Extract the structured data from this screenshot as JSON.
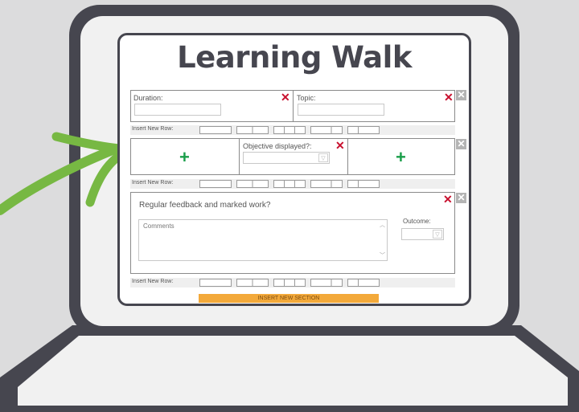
{
  "page": {
    "title": "Learning Walk"
  },
  "row1": {
    "duration_label": "Duration:",
    "topic_label": "Topic:"
  },
  "insert_row_label": "Insert New Row:",
  "row2": {
    "objective_label": "Objective displayed?:"
  },
  "row3": {
    "question": "Regular feedback and marked work?",
    "comments_placeholder": "Comments",
    "outcome_label": "Outcome:"
  },
  "insert_section_label": "INSERT NEW SECTION",
  "icons": {
    "remove_cell": "x-icon",
    "remove_row": "close-box-icon",
    "add_cell": "plus-icon",
    "arrow": "arrow-icon"
  },
  "colors": {
    "frame": "#46464f",
    "remove_red": "#c8102e",
    "add_green": "#1a9e4a",
    "arrow_green": "#77b843",
    "insert_orange": "#f3a93a"
  }
}
